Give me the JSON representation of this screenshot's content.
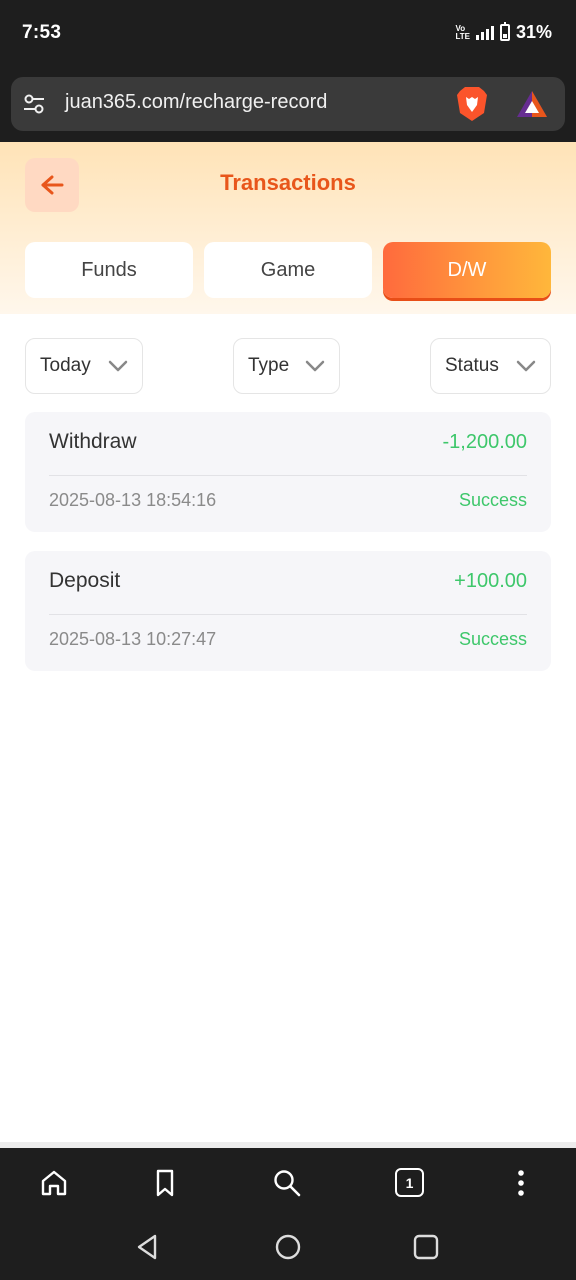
{
  "status_bar": {
    "time": "7:53",
    "network_top": "Vo",
    "network_bottom": "LTE",
    "battery": "31%"
  },
  "browser": {
    "url": "juan365.com/recharge-record",
    "brave_icon": "brave-lion-icon",
    "rewards_icon": "brave-rewards-triangle-icon"
  },
  "header": {
    "title": "Transactions",
    "back_icon": "arrow-left-icon"
  },
  "tabs": [
    {
      "label": "Funds",
      "active": false
    },
    {
      "label": "Game",
      "active": false
    },
    {
      "label": "D/W",
      "active": true
    }
  ],
  "filters": [
    {
      "label": "Today"
    },
    {
      "label": "Type"
    },
    {
      "label": "Status"
    }
  ],
  "records": [
    {
      "type": "Withdraw",
      "amount": "-1,200.00",
      "datetime": "2025-08-13 18:54:16",
      "status": "Success"
    },
    {
      "type": "Deposit",
      "amount": "+100.00",
      "datetime": "2025-08-13 10:27:47",
      "status": "Success"
    }
  ],
  "toolbar": {
    "tab_count": "1"
  },
  "colors": {
    "accent": "#e8561b",
    "success": "#3ec76b",
    "active_tab_start": "#ff6a3d",
    "active_tab_end": "#ffb73b"
  }
}
